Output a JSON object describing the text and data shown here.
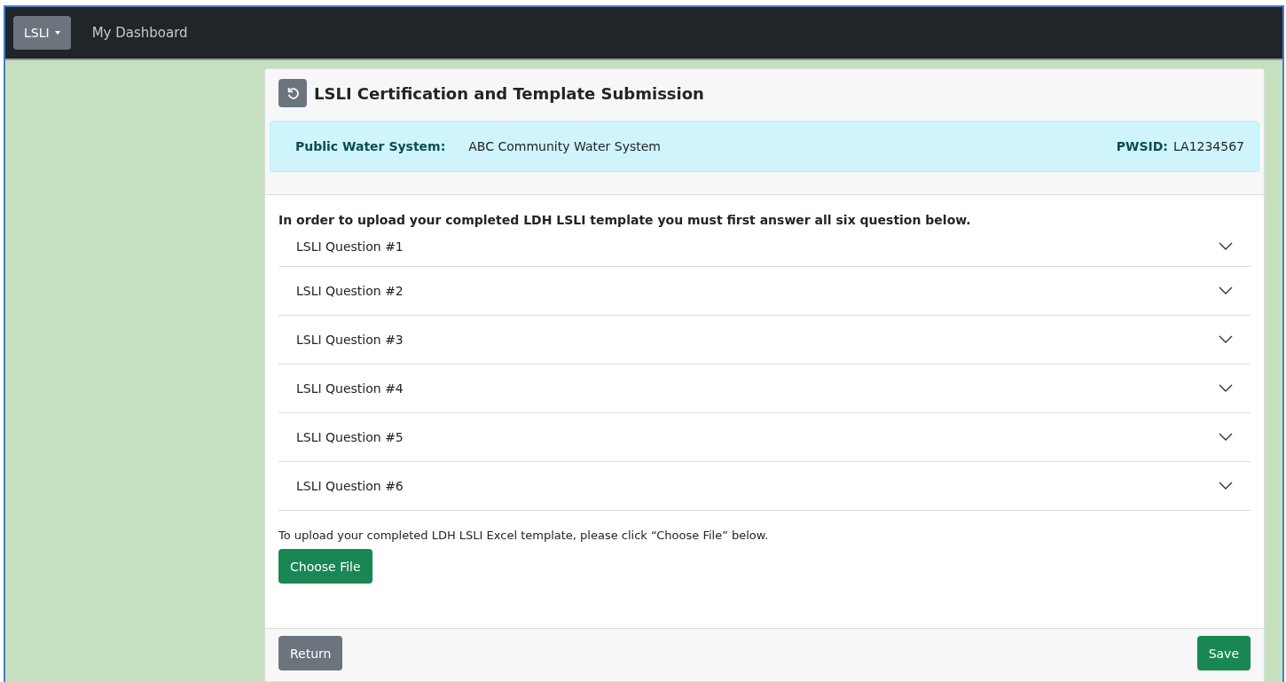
{
  "navbar": {
    "menu_button": "LSLI",
    "links": [
      "My Dashboard"
    ]
  },
  "card": {
    "title": "LSLI Certification and Template Submission",
    "system": {
      "label": "Public Water System:",
      "value": "ABC Community Water System",
      "id_label": "PWSID:",
      "id_value": "LA1234567"
    },
    "instructions": "In order to upload your completed LDH LSLI template you must first answer all six question below.",
    "questions": [
      {
        "label": "LSLI Question #1",
        "expanded": false
      },
      {
        "label": "LSLI Question #2",
        "expanded": false
      },
      {
        "label": "LSLI Question #3",
        "expanded": false
      },
      {
        "label": "LSLI Question #4",
        "expanded": false
      },
      {
        "label": "LSLI Question #5",
        "expanded": false
      },
      {
        "label": "LSLI Question #6",
        "expanded": false
      }
    ],
    "upload_text": "To upload your completed LDH LSLI Excel template, please click “Choose File” below.",
    "choose_file": "Choose File",
    "footer": {
      "return": "Return",
      "save": "Save"
    }
  }
}
